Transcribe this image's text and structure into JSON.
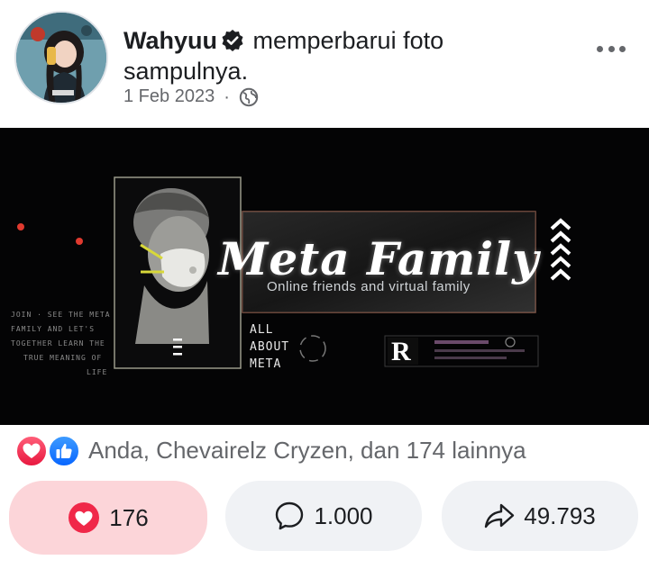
{
  "post": {
    "author": "Wahyuu",
    "action": "memperbarui foto",
    "action_cont": "sampulnya.",
    "date": "1 Feb 2023",
    "separator": "·"
  },
  "cover": {
    "title": "Meta Family",
    "subtitle": "Online friends and virtual family",
    "side_lines": [
      "ALL",
      "ABOUT",
      "META"
    ],
    "badge_letter": "R",
    "tiny_lines": [
      "JOIN · SEE THE META",
      "FAMILY AND LET'S",
      "TOGETHER LEARN THE",
      "TRUE MEANING OF",
      "LIFE"
    ]
  },
  "reactions": {
    "summary": "Anda, Chevairelz Cryzen, dan 174 lainnya",
    "icons": [
      "love-icon",
      "like-icon"
    ]
  },
  "actions": {
    "love_count": "176",
    "comment_count": "1.000",
    "share_count": "49.793"
  },
  "colors": {
    "accent_love": "#f02849",
    "accent_like": "#0866ff",
    "like_button_bg": "#fcd5d9",
    "neutral_button_bg": "#f0f2f5",
    "muted_text": "#65676b"
  }
}
